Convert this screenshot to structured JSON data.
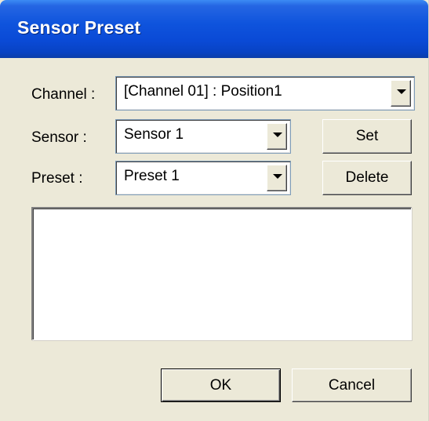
{
  "window": {
    "title": "Sensor Preset"
  },
  "fields": {
    "channel": {
      "label": "Channel :",
      "value": "[Channel 01] : Position1"
    },
    "sensor": {
      "label": "Sensor :",
      "value": "Sensor 1"
    },
    "preset": {
      "label": "Preset :",
      "value": "Preset 1"
    }
  },
  "buttons": {
    "set": "Set",
    "delete": "Delete",
    "ok": "OK",
    "cancel": "Cancel"
  },
  "list": {
    "items": []
  }
}
